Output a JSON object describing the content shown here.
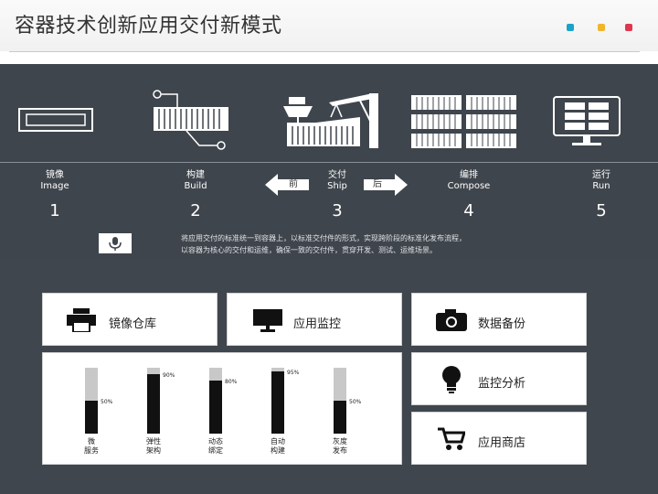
{
  "title": "容器技术创新应用交付新模式",
  "colors": {
    "dot1": "#1aa3c9",
    "dot2": "#f0b52a",
    "dot3": "#e0364e",
    "dark": "#3f454c"
  },
  "steps": [
    {
      "cn": "镜像",
      "en": "Image",
      "num": "1",
      "icon": "image-frame-icon"
    },
    {
      "cn": "构建",
      "en": "Build",
      "num": "2",
      "icon": "container-build-icon"
    },
    {
      "cn": "交付",
      "en": "Ship",
      "num": "3",
      "icon": "crane-ship-icon"
    },
    {
      "cn": "编排",
      "en": "Compose",
      "num": "4",
      "icon": "stacked-containers-icon"
    },
    {
      "cn": "运行",
      "en": "Run",
      "num": "5",
      "icon": "monitor-run-icon"
    }
  ],
  "arrows": {
    "prev": "前",
    "next": "后"
  },
  "description": {
    "line1": "将应用交付的标准统一到容器上，以标准交付件的形式，实现跨阶段的标准化发布流程，",
    "line2": "以容器为核心的交付和运维，确保一致的交付件，贯穿开发、测试、运维场景。"
  },
  "cards": {
    "registry": "镜像仓库",
    "monitor": "应用监控",
    "backup": "数据备份",
    "analysis": "监控分析",
    "store": "应用商店"
  },
  "chart_data": {
    "type": "bar",
    "categories": [
      "微\n服务",
      "弹性\n架构",
      "动态\n绑定",
      "自动\n构建",
      "灰度\n发布"
    ],
    "values": [
      50,
      90,
      80,
      95,
      50
    ],
    "labels": [
      "50%",
      "90%",
      "80%",
      "95%",
      "50%"
    ],
    "ylim": [
      0,
      100
    ]
  }
}
